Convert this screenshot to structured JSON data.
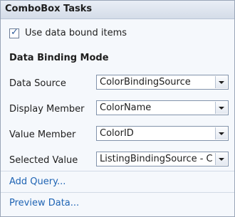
{
  "panel": {
    "title": "ComboBox Tasks"
  },
  "use_data_bound": {
    "label": "Use data bound items",
    "checked": true
  },
  "binding": {
    "heading": "Data Binding Mode",
    "rows": [
      {
        "label": "Data Source",
        "value": "ColorBindingSource"
      },
      {
        "label": "Display Member",
        "value": "ColorName"
      },
      {
        "label": "Value Member",
        "value": "ColorID"
      },
      {
        "label": "Selected Value",
        "value": "ListingBindingSource - C"
      }
    ]
  },
  "links": {
    "add_query": "Add Query...",
    "preview_data": "Preview Data..."
  },
  "icons": [
    "checkmark-icon",
    "chevron-down-icon"
  ]
}
